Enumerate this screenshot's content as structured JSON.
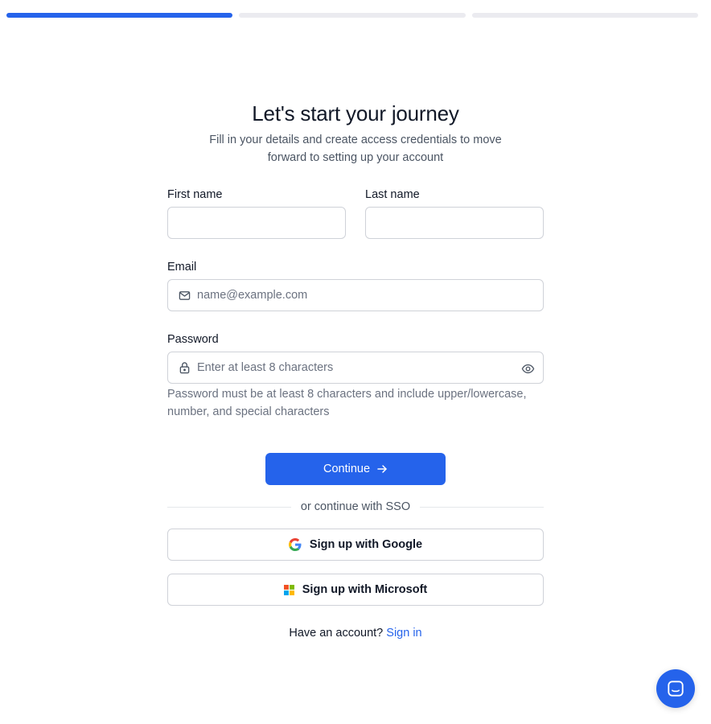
{
  "progress": {
    "steps_total": 3,
    "current_step": 1,
    "active_color": "#2563eb",
    "inactive_color": "#ebebf0"
  },
  "header": {
    "title": "Let's start your journey",
    "subtitle": "Fill in your details and create access credentials to move forward to setting up your account"
  },
  "form": {
    "first_name": {
      "label": "First name",
      "value": "",
      "placeholder": ""
    },
    "last_name": {
      "label": "Last name",
      "value": "",
      "placeholder": ""
    },
    "email": {
      "label": "Email",
      "value": "",
      "placeholder": "name@example.com",
      "icon": "mail-icon"
    },
    "password": {
      "label": "Password",
      "value": "",
      "placeholder": "Enter at least 8 characters",
      "icon": "lock-icon",
      "toggle_icon": "eye-icon",
      "help": "Password must be at least 8 characters and include upper/lowercase, number, and special characters"
    },
    "continue_label": "Continue"
  },
  "sso": {
    "divider_text": "or continue with SSO",
    "google_label": "Sign up with Google",
    "microsoft_label": "Sign up with Microsoft"
  },
  "footer": {
    "prompt": "Have an account?",
    "link": "Sign in"
  },
  "colors": {
    "primary": "#2563eb",
    "border": "#cfd2d8",
    "muted_text": "#6b7280"
  }
}
